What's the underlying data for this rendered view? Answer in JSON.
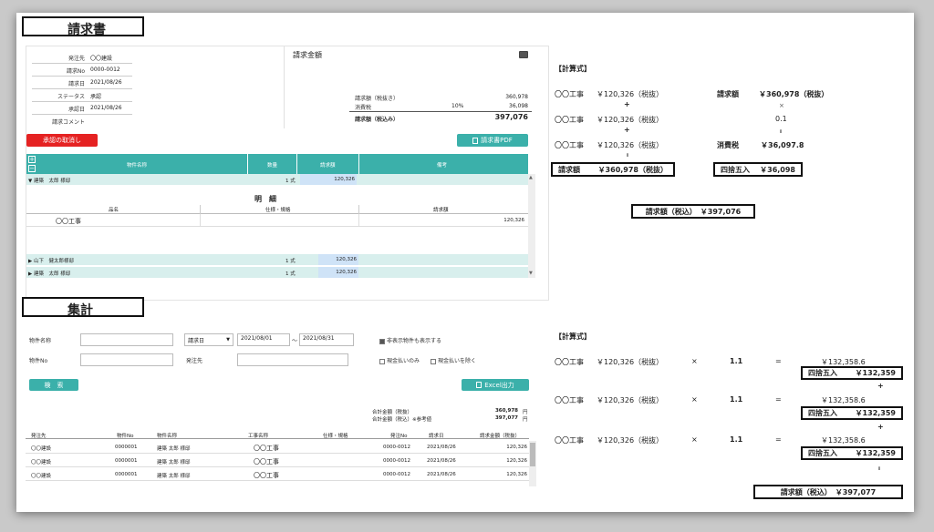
{
  "invoice": {
    "section_title": "請求書",
    "fields": [
      {
        "label": "発注先",
        "value": "〇〇建設"
      },
      {
        "label": "請求No",
        "value": "0000-0012"
      },
      {
        "label": "請求日",
        "value": "2021/08/26"
      },
      {
        "label": "ステータス",
        "value": "承認"
      },
      {
        "label": "承認日",
        "value": "2021/08/26"
      },
      {
        "label": "請求コメント",
        "value": ""
      }
    ],
    "amount_title": "請求金額",
    "subtotal_label": "請求額（税抜き）",
    "subtotal_value": "360,978",
    "tax_label": "消費税",
    "tax_rate": "10%",
    "tax_value": "36,098",
    "total_label": "請求額（税込み）",
    "total_value": "397,076",
    "cancel_button": "承認の取消し",
    "pdf_button": "請求書PDF",
    "table_headers": [
      "物件名称",
      "数量",
      "請求額",
      "備考"
    ],
    "rows": [
      {
        "name": "▼ 建築　太郎 様邸",
        "qty": "1 式",
        "amount": "120,326"
      },
      {
        "name": "▶ 山下　健太郎様邸",
        "qty": "1 式",
        "amount": "120,326"
      },
      {
        "name": "▶ 建築　太郎 様邸",
        "qty": "1 式",
        "amount": "120,326"
      }
    ],
    "detail_title": "明　細",
    "detail_headers": [
      "品名",
      "仕様・規格",
      "請求額"
    ],
    "detail_row": {
      "name": "〇〇工事",
      "amount": "120,326"
    }
  },
  "calc1": {
    "title": "【計算式】",
    "lines": [
      {
        "item": "〇〇工事",
        "amount": "￥120,326（税抜）"
      },
      {
        "item": "〇〇工事",
        "amount": "￥120,326（税抜）"
      },
      {
        "item": "〇〇工事",
        "amount": "￥120,326（税抜）"
      }
    ],
    "plus": "+",
    "equals_v": "॥",
    "times": "×",
    "right_label1": "請求額",
    "right_value1": "￥360,978（税抜）",
    "right_rate": "0.1",
    "right_label2": "消費税",
    "right_value2": "￥36,097.8",
    "box1_label": "請求額",
    "box1_value": "￥360,978（税抜）",
    "box2_label": "四捨五入",
    "box2_value": "￥36,098",
    "total_box": "請求額（税込）　￥397,076"
  },
  "summary": {
    "section_title": "集計",
    "property_name_label": "物件名称",
    "property_no_label": "物件No",
    "date_type": "請求日",
    "date_from": "2021/08/01",
    "date_tilde": "〜",
    "date_to": "2021/08/31",
    "vendor_label": "発注先",
    "show_hidden": "非表示物件も表示する",
    "fixed_only": "現金払いのみ",
    "exclude_fixed": "現金払いを除く",
    "search_button": "検　索",
    "excel_button": "Excel出力",
    "sum_excl_label": "合計金額（税抜）",
    "sum_excl_value": "360,978",
    "sum_incl_label": "合計金額（税込）※参考値",
    "sum_incl_value": "397,077",
    "yen": "円",
    "headers": [
      "発注先",
      "物件No",
      "物件名称",
      "工事名称",
      "仕様・規格",
      "発注No",
      "請求日",
      "請求金額（税抜）"
    ],
    "rows": [
      [
        "〇〇建設",
        "0000001",
        "建築 太郎 様邸",
        "〇〇工事",
        "",
        "0000-0012",
        "2021/08/26",
        "120,326"
      ],
      [
        "〇〇建設",
        "0000001",
        "建築 太郎 様邸",
        "〇〇工事",
        "",
        "0000-0012",
        "2021/08/26",
        "120,326"
      ],
      [
        "〇〇建設",
        "0000001",
        "建築 太郎 様邸",
        "〇〇工事",
        "",
        "0000-0012",
        "2021/08/26",
        "120,326"
      ]
    ]
  },
  "calc2": {
    "title": "【計算式】",
    "lines": [
      {
        "item": "〇〇工事",
        "amount": "￥120,326（税抜）",
        "times": "×",
        "rate": "1.1",
        "eq": "=",
        "result": "￥132,358.6",
        "box_label": "四捨五入",
        "box_value": "￥132,359"
      },
      {
        "item": "〇〇工事",
        "amount": "￥120,326（税抜）",
        "times": "×",
        "rate": "1.1",
        "eq": "=",
        "result": "￥132,358.6",
        "box_label": "四捨五入",
        "box_value": "￥132,359"
      },
      {
        "item": "〇〇工事",
        "amount": "￥120,326（税抜）",
        "times": "×",
        "rate": "1.1",
        "eq": "=",
        "result": "￥132,358.6",
        "box_label": "四捨五入",
        "box_value": "￥132,359"
      }
    ],
    "plus": "+",
    "equals_v": "॥",
    "total_box": "請求額（税込）　￥397,077"
  }
}
